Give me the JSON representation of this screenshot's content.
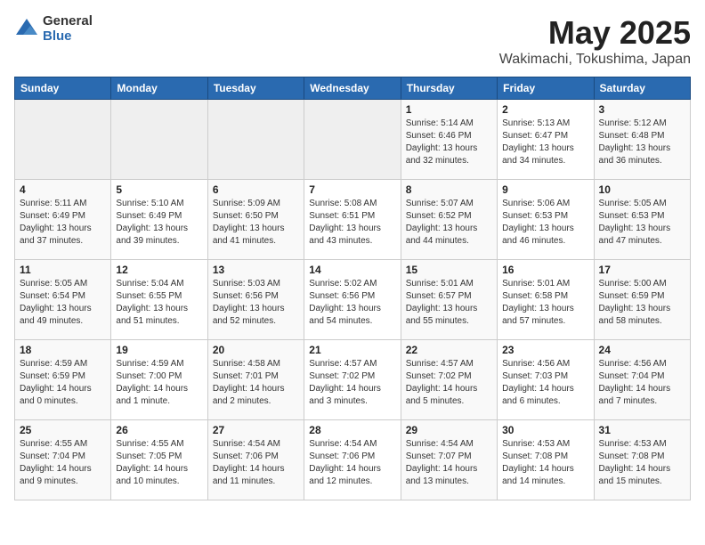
{
  "logo": {
    "general": "General",
    "blue": "Blue"
  },
  "title": "May 2025",
  "location": "Wakimachi, Tokushima, Japan",
  "days_of_week": [
    "Sunday",
    "Monday",
    "Tuesday",
    "Wednesday",
    "Thursday",
    "Friday",
    "Saturday"
  ],
  "weeks": [
    [
      {
        "day": "",
        "empty": true
      },
      {
        "day": "",
        "empty": true
      },
      {
        "day": "",
        "empty": true
      },
      {
        "day": "",
        "empty": true
      },
      {
        "day": "1",
        "sunrise": "5:14 AM",
        "sunset": "6:46 PM",
        "daylight": "13 hours and 32 minutes."
      },
      {
        "day": "2",
        "sunrise": "5:13 AM",
        "sunset": "6:47 PM",
        "daylight": "13 hours and 34 minutes."
      },
      {
        "day": "3",
        "sunrise": "5:12 AM",
        "sunset": "6:48 PM",
        "daylight": "13 hours and 36 minutes."
      }
    ],
    [
      {
        "day": "4",
        "sunrise": "5:11 AM",
        "sunset": "6:49 PM",
        "daylight": "13 hours and 37 minutes."
      },
      {
        "day": "5",
        "sunrise": "5:10 AM",
        "sunset": "6:49 PM",
        "daylight": "13 hours and 39 minutes."
      },
      {
        "day": "6",
        "sunrise": "5:09 AM",
        "sunset": "6:50 PM",
        "daylight": "13 hours and 41 minutes."
      },
      {
        "day": "7",
        "sunrise": "5:08 AM",
        "sunset": "6:51 PM",
        "daylight": "13 hours and 43 minutes."
      },
      {
        "day": "8",
        "sunrise": "5:07 AM",
        "sunset": "6:52 PM",
        "daylight": "13 hours and 44 minutes."
      },
      {
        "day": "9",
        "sunrise": "5:06 AM",
        "sunset": "6:53 PM",
        "daylight": "13 hours and 46 minutes."
      },
      {
        "day": "10",
        "sunrise": "5:05 AM",
        "sunset": "6:53 PM",
        "daylight": "13 hours and 47 minutes."
      }
    ],
    [
      {
        "day": "11",
        "sunrise": "5:05 AM",
        "sunset": "6:54 PM",
        "daylight": "13 hours and 49 minutes."
      },
      {
        "day": "12",
        "sunrise": "5:04 AM",
        "sunset": "6:55 PM",
        "daylight": "13 hours and 51 minutes."
      },
      {
        "day": "13",
        "sunrise": "5:03 AM",
        "sunset": "6:56 PM",
        "daylight": "13 hours and 52 minutes."
      },
      {
        "day": "14",
        "sunrise": "5:02 AM",
        "sunset": "6:56 PM",
        "daylight": "13 hours and 54 minutes."
      },
      {
        "day": "15",
        "sunrise": "5:01 AM",
        "sunset": "6:57 PM",
        "daylight": "13 hours and 55 minutes."
      },
      {
        "day": "16",
        "sunrise": "5:01 AM",
        "sunset": "6:58 PM",
        "daylight": "13 hours and 57 minutes."
      },
      {
        "day": "17",
        "sunrise": "5:00 AM",
        "sunset": "6:59 PM",
        "daylight": "13 hours and 58 minutes."
      }
    ],
    [
      {
        "day": "18",
        "sunrise": "4:59 AM",
        "sunset": "6:59 PM",
        "daylight": "14 hours and 0 minutes."
      },
      {
        "day": "19",
        "sunrise": "4:59 AM",
        "sunset": "7:00 PM",
        "daylight": "14 hours and 1 minute."
      },
      {
        "day": "20",
        "sunrise": "4:58 AM",
        "sunset": "7:01 PM",
        "daylight": "14 hours and 2 minutes."
      },
      {
        "day": "21",
        "sunrise": "4:57 AM",
        "sunset": "7:02 PM",
        "daylight": "14 hours and 3 minutes."
      },
      {
        "day": "22",
        "sunrise": "4:57 AM",
        "sunset": "7:02 PM",
        "daylight": "14 hours and 5 minutes."
      },
      {
        "day": "23",
        "sunrise": "4:56 AM",
        "sunset": "7:03 PM",
        "daylight": "14 hours and 6 minutes."
      },
      {
        "day": "24",
        "sunrise": "4:56 AM",
        "sunset": "7:04 PM",
        "daylight": "14 hours and 7 minutes."
      }
    ],
    [
      {
        "day": "25",
        "sunrise": "4:55 AM",
        "sunset": "7:04 PM",
        "daylight": "14 hours and 9 minutes."
      },
      {
        "day": "26",
        "sunrise": "4:55 AM",
        "sunset": "7:05 PM",
        "daylight": "14 hours and 10 minutes."
      },
      {
        "day": "27",
        "sunrise": "4:54 AM",
        "sunset": "7:06 PM",
        "daylight": "14 hours and 11 minutes."
      },
      {
        "day": "28",
        "sunrise": "4:54 AM",
        "sunset": "7:06 PM",
        "daylight": "14 hours and 12 minutes."
      },
      {
        "day": "29",
        "sunrise": "4:54 AM",
        "sunset": "7:07 PM",
        "daylight": "14 hours and 13 minutes."
      },
      {
        "day": "30",
        "sunrise": "4:53 AM",
        "sunset": "7:08 PM",
        "daylight": "14 hours and 14 minutes."
      },
      {
        "day": "31",
        "sunrise": "4:53 AM",
        "sunset": "7:08 PM",
        "daylight": "14 hours and 15 minutes."
      }
    ]
  ]
}
